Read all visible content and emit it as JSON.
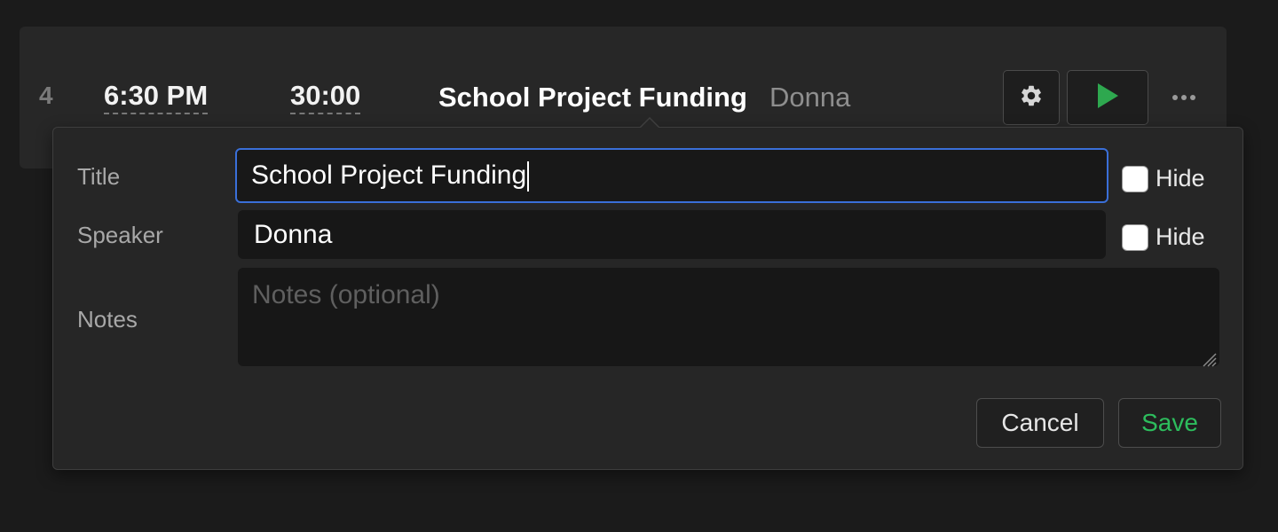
{
  "row": {
    "number": "4",
    "start_time": "6:30 PM",
    "duration": "30:00",
    "title": "School Project Funding",
    "speaker": "Donna",
    "icons": {
      "settings": "gear-icon",
      "play": "play-icon",
      "more": "more-horizontal-icon"
    },
    "colors": {
      "play_accent": "#2ea84f"
    }
  },
  "editor": {
    "title_label": "Title",
    "title_value": "School Project Funding",
    "speaker_label": "Speaker",
    "speaker_value": "Donna",
    "notes_label": "Notes",
    "notes_value": "",
    "notes_placeholder": "Notes (optional)",
    "hide_title_label": "Hide",
    "hide_speaker_label": "Hide",
    "hide_title_checked": false,
    "hide_speaker_checked": false,
    "cancel_label": "Cancel",
    "save_label": "Save",
    "colors": {
      "focus_ring": "#3a6fd8",
      "save_text": "#2dbd5d"
    }
  }
}
